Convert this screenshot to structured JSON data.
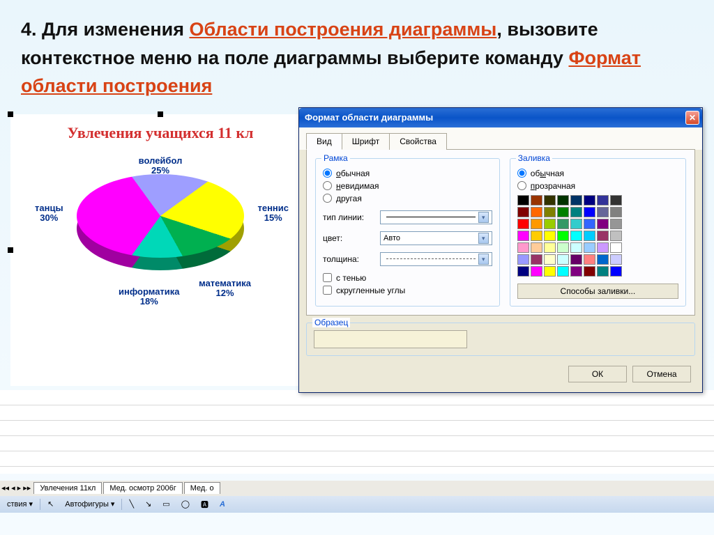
{
  "instruction": {
    "prefix": "4. Для изменения ",
    "hl1": "Области построения диаграммы",
    "mid1": ", вызовите контекстное меню на поле диаграммы выберите команду ",
    "hl2": "Формат области построения"
  },
  "chart_data": {
    "type": "pie",
    "title": "Увлечения учащихся 11 кл",
    "series": [
      {
        "name": "волейбол",
        "value": 25,
        "color": "#9e9eff"
      },
      {
        "name": "теннис",
        "value": 15,
        "color": "#ffff00"
      },
      {
        "name": "математика",
        "value": 12,
        "color": "#00b050"
      },
      {
        "name": "информатика",
        "value": 18,
        "color": "#00d8b8"
      },
      {
        "name": "танцы",
        "value": 30,
        "color": "#ff00ff"
      }
    ],
    "labels": {
      "volley": "волейбол\n25%",
      "tennis": "теннис\n15%",
      "math": "математика\n12%",
      "info": "информатика\n18%",
      "dance": "танцы\n30%"
    }
  },
  "sheets": {
    "navs": "◂◂ ◂ ▸ ▸▸",
    "tab1": "Увлечения 11кл",
    "tab2": "Мед. осмотр 2006г",
    "tab3": "Мед. о"
  },
  "drawbar": {
    "actions": "ствия ▾",
    "autoshapes": "Автофигуры ▾"
  },
  "dialog": {
    "title": "Формат области диаграммы",
    "tabs": {
      "view": "Вид",
      "font": "Шрифт",
      "props": "Свойства"
    },
    "frame": {
      "legend": "Рамка",
      "r_normal": "обычная",
      "r_invisible": "невидимая",
      "r_other": "другая",
      "line_type": "тип линии:",
      "color": "цвет:",
      "color_val": "Авто",
      "thickness": "толщина:",
      "shadow": "с тенью",
      "rounded": "скругленные углы"
    },
    "fill": {
      "legend": "Заливка",
      "r_normal": "обычная",
      "r_transparent": "прозрачная",
      "methods": "Способы заливки..."
    },
    "sample": {
      "legend": "Образец"
    },
    "buttons": {
      "ok": "ОК",
      "cancel": "Отмена"
    },
    "palette": [
      "#000000",
      "#993300",
      "#333300",
      "#003300",
      "#003366",
      "#000080",
      "#333399",
      "#333333",
      "#800000",
      "#ff6600",
      "#808000",
      "#008000",
      "#008080",
      "#0000ff",
      "#666699",
      "#808080",
      "#ff0000",
      "#ff9900",
      "#99cc00",
      "#339966",
      "#33cccc",
      "#3366ff",
      "#800080",
      "#969696",
      "#ff00ff",
      "#ffcc00",
      "#ffff00",
      "#00ff00",
      "#00ffff",
      "#00ccff",
      "#993366",
      "#c0c0c0",
      "#ff99cc",
      "#ffcc99",
      "#ffff99",
      "#ccffcc",
      "#ccffff",
      "#99ccff",
      "#cc99ff",
      "#ffffff",
      "#9999ff",
      "#993366",
      "#ffffcc",
      "#ccffff",
      "#660066",
      "#ff8080",
      "#0066cc",
      "#ccccff",
      "#000080",
      "#ff00ff",
      "#ffff00",
      "#00ffff",
      "#800080",
      "#800000",
      "#008080",
      "#0000ff"
    ]
  }
}
